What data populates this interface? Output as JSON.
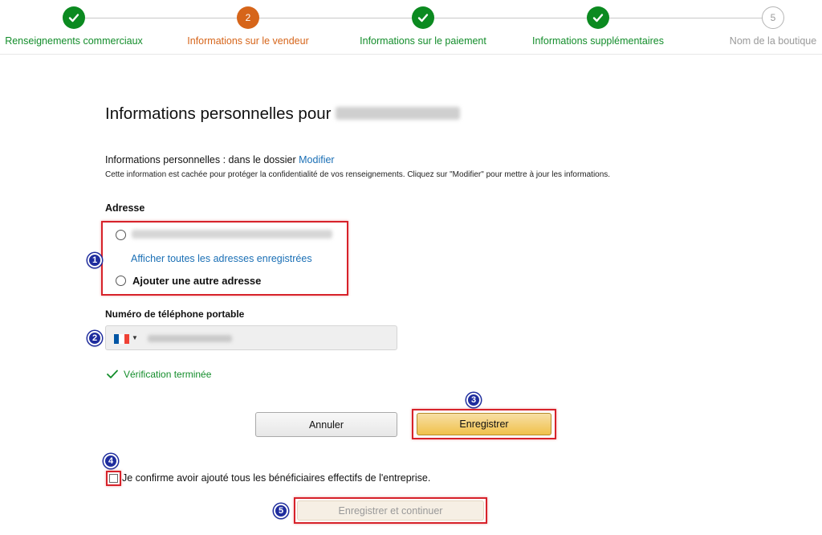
{
  "stepper": {
    "steps": [
      {
        "label": "Renseignements commerciaux",
        "status": "done"
      },
      {
        "label": "Informations sur le vendeur",
        "status": "current",
        "number": "2"
      },
      {
        "label": "Informations sur le paiement",
        "status": "done"
      },
      {
        "label": "Informations supplémentaires",
        "status": "done"
      },
      {
        "label": "Nom de la boutique",
        "status": "future",
        "number": "5"
      }
    ]
  },
  "page": {
    "title": "Informations personnelles pour",
    "info_line": "Informations personnelles : dans le dossier",
    "modify_link": "Modifier",
    "info_small": "Cette information est cachée pour protéger la confidentialité de vos renseignements. Cliquez sur \"Modifier\" pour mettre à jour les informations."
  },
  "address": {
    "label": "Adresse",
    "show_all_link": "Afficher toutes les adresses enregistrées",
    "add_option": "Ajouter une autre adresse"
  },
  "phone": {
    "label": "Numéro de téléphone portable",
    "country": "France",
    "flag_colors": [
      "#0055a4",
      "#ffffff",
      "#ef4135"
    ]
  },
  "verification": {
    "text": "Vérification terminée",
    "icon": "check-icon"
  },
  "buttons": {
    "cancel": "Annuler",
    "save": "Enregistrer",
    "save_continue": "Enregistrer et continuer"
  },
  "confirm": {
    "text": "Je confirme avoir ajouté tous les bénéficiaires effectifs de l'entreprise."
  },
  "annotations": {
    "badges": [
      "1",
      "2",
      "3",
      "4",
      "5"
    ],
    "color": "#d7222a",
    "badge_color": "#1f2d9e"
  },
  "colors": {
    "done": "#138d2b",
    "current": "#d6651a",
    "link": "#1a6fb5"
  }
}
